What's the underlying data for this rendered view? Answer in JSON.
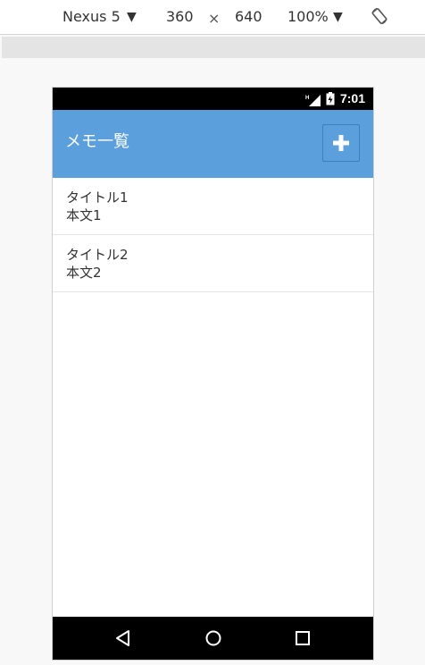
{
  "devtools": {
    "device": "Nexus 5",
    "width": "360",
    "times": "×",
    "height": "640",
    "zoom": "100%",
    "dropdown_arrow": "▼"
  },
  "status_bar": {
    "time": "7:01",
    "network": "H"
  },
  "app_bar": {
    "title": "メモ一覧",
    "add_icon": "plus-icon"
  },
  "memos": [
    {
      "title": "タイトル1",
      "body": "本文1"
    },
    {
      "title": "タイトル2",
      "body": "本文2"
    }
  ],
  "nav_bar": {
    "back_icon": "back-icon",
    "home_icon": "home-icon",
    "recents_icon": "recents-icon"
  },
  "colors": {
    "accent": "#5b9fdd"
  }
}
